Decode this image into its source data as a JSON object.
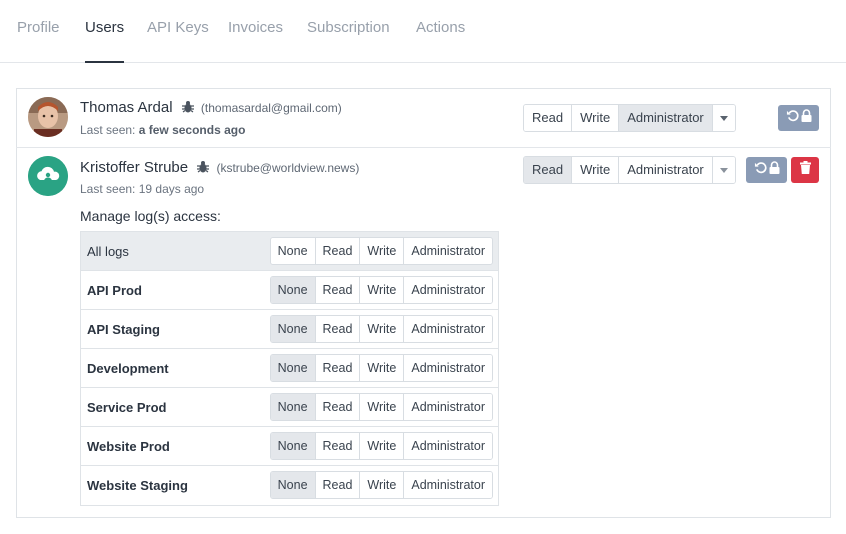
{
  "tabs": [
    "Profile",
    "Users",
    "API Keys",
    "Invoices",
    "Subscription",
    "Actions"
  ],
  "active_tab": "Users",
  "users": [
    {
      "name": "Thomas Ardal",
      "email": "(thomasardal@gmail.com)",
      "last_seen_prefix": "Last seen: ",
      "last_seen_value": "a few seconds ago",
      "role_options": [
        "Read",
        "Write",
        "Administrator"
      ],
      "selected_role": "Administrator"
    },
    {
      "name": "Kristoffer Strube",
      "email": "(kstrube@worldview.news)",
      "last_seen_prefix": "Last seen: ",
      "last_seen_value": "19 days ago",
      "role_options": [
        "Read",
        "Write",
        "Administrator"
      ],
      "selected_role": "Read"
    }
  ],
  "manage_access_title": "Manage log(s) access:",
  "access_levels": [
    "None",
    "Read",
    "Write",
    "Administrator"
  ],
  "logs": [
    {
      "name": "All logs",
      "selected": ""
    },
    {
      "name": "API Prod",
      "selected": "None"
    },
    {
      "name": "API Staging",
      "selected": "None"
    },
    {
      "name": "Development",
      "selected": "None"
    },
    {
      "name": "Service Prod",
      "selected": "None"
    },
    {
      "name": "Website Prod",
      "selected": "None"
    },
    {
      "name": "Website Staging",
      "selected": "None"
    }
  ],
  "colors": {
    "reset_button": "#8a9bb5",
    "delete_button": "#dc3545",
    "avatar_green": "#2aa384"
  },
  "icons": {
    "user1_actions": [
      "undo-icon",
      "lock-icon"
    ],
    "user2_actions": [
      "undo-icon",
      "lock-icon",
      "trash-icon"
    ],
    "role_badge": "bug-icon"
  }
}
